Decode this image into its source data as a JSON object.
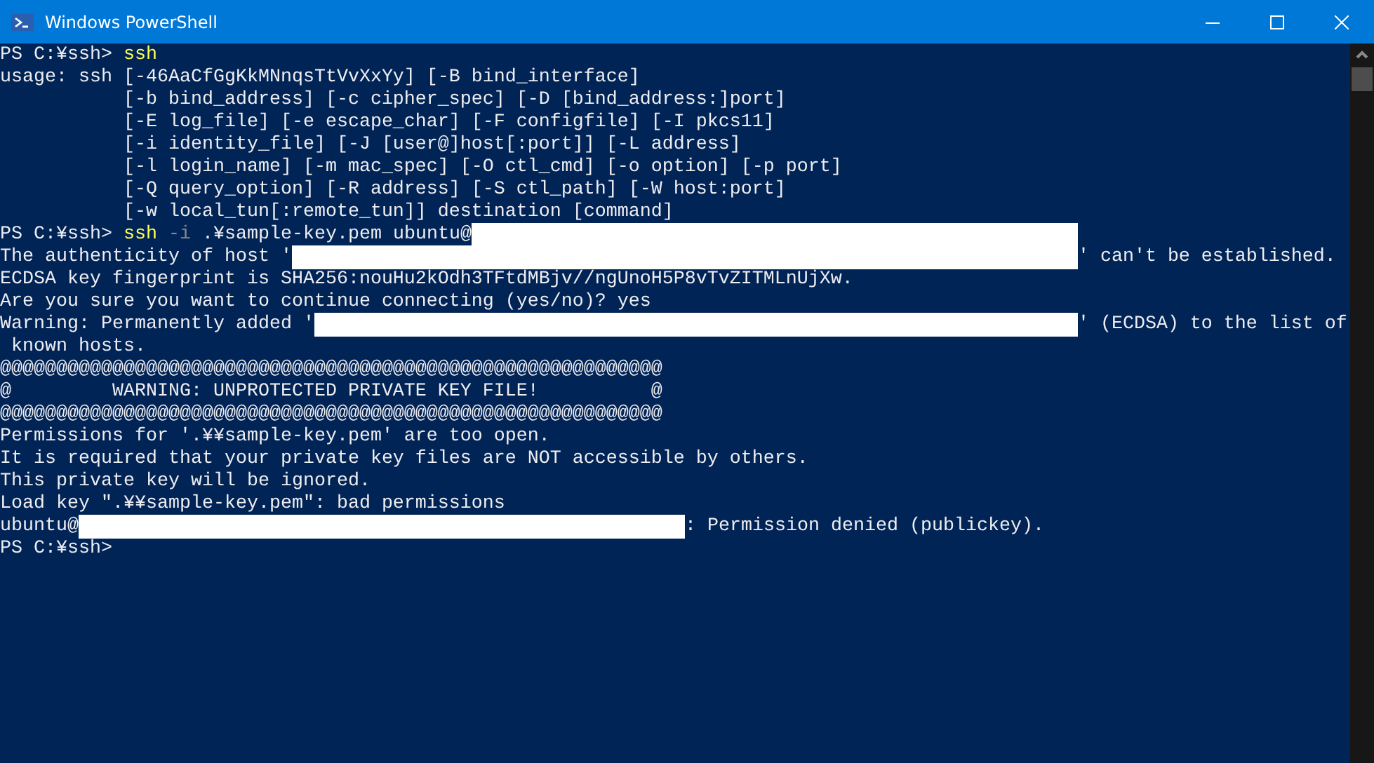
{
  "window": {
    "title": "Windows PowerShell"
  },
  "console_lines": [
    [
      {
        "kind": "text",
        "text": "PS C:¥ssh> "
      },
      {
        "kind": "command",
        "text": "ssh"
      }
    ],
    [
      {
        "kind": "text",
        "text": "usage: ssh [-46AaCfGgKkMNnqsTtVvXxYy] [-B bind_interface]"
      }
    ],
    [
      {
        "kind": "text",
        "text": "           [-b bind_address] [-c cipher_spec] [-D [bind_address:]port]"
      }
    ],
    [
      {
        "kind": "text",
        "text": "           [-E log_file] [-e escape_char] [-F configfile] [-I pkcs11]"
      }
    ],
    [
      {
        "kind": "text",
        "text": "           [-i identity_file] [-J [user@]host[:port]] [-L address]"
      }
    ],
    [
      {
        "kind": "text",
        "text": "           [-l login_name] [-m mac_spec] [-O ctl_cmd] [-o option] [-p port]"
      }
    ],
    [
      {
        "kind": "text",
        "text": "           [-Q query_option] [-R address] [-S ctl_path] [-W host:port]"
      }
    ],
    [
      {
        "kind": "text",
        "text": "           [-w local_tun[:remote_tun]] destination [command]"
      }
    ],
    [
      {
        "kind": "text",
        "text": "PS C:¥ssh> "
      },
      {
        "kind": "command",
        "text": "ssh"
      },
      {
        "kind": "param",
        "text": " -i"
      },
      {
        "kind": "text",
        "text": " .¥sample-key.pem ubuntu@"
      },
      {
        "kind": "redacted"
      }
    ],
    [
      {
        "kind": "text",
        "text": "The authenticity of host '"
      },
      {
        "kind": "redacted"
      },
      {
        "kind": "text",
        "text": "' can't be established."
      }
    ],
    [
      {
        "kind": "text",
        "text": "ECDSA key fingerprint is SHA256:nouHu2kOdh3TFtdMBjv//ngUnoH5P8vTvZITMLnUjXw."
      }
    ],
    [
      {
        "kind": "text",
        "text": "Are you sure you want to continue connecting (yes/no)? yes"
      }
    ],
    [
      {
        "kind": "text",
        "text": "Warning: Permanently added '"
      },
      {
        "kind": "redacted"
      },
      {
        "kind": "text",
        "text": "' (ECDSA) to the list of"
      }
    ],
    [
      {
        "kind": "text",
        "text": " known hosts."
      }
    ],
    [
      {
        "kind": "text",
        "text": "@@@@@@@@@@@@@@@@@@@@@@@@@@@@@@@@@@@@@@@@@@@@@@@@@@@@@@@@@@@"
      }
    ],
    [
      {
        "kind": "text",
        "text": "@         WARNING: UNPROTECTED PRIVATE KEY FILE!          @"
      }
    ],
    [
      {
        "kind": "text",
        "text": "@@@@@@@@@@@@@@@@@@@@@@@@@@@@@@@@@@@@@@@@@@@@@@@@@@@@@@@@@@@"
      }
    ],
    [
      {
        "kind": "text",
        "text": "Permissions for '.¥¥sample-key.pem' are too open."
      }
    ],
    [
      {
        "kind": "text",
        "text": "It is required that your private key files are NOT accessible by others."
      }
    ],
    [
      {
        "kind": "text",
        "text": "This private key will be ignored."
      }
    ],
    [
      {
        "kind": "text",
        "text": "Load key \".¥¥sample-key.pem\": bad permissions"
      }
    ],
    [
      {
        "kind": "text",
        "text": "ubuntu@"
      },
      {
        "kind": "redacted"
      },
      {
        "kind": "text",
        "text": ": Permission denied (publickey)."
      }
    ],
    [
      {
        "kind": "text",
        "text": "PS C:¥ssh>"
      }
    ]
  ]
}
